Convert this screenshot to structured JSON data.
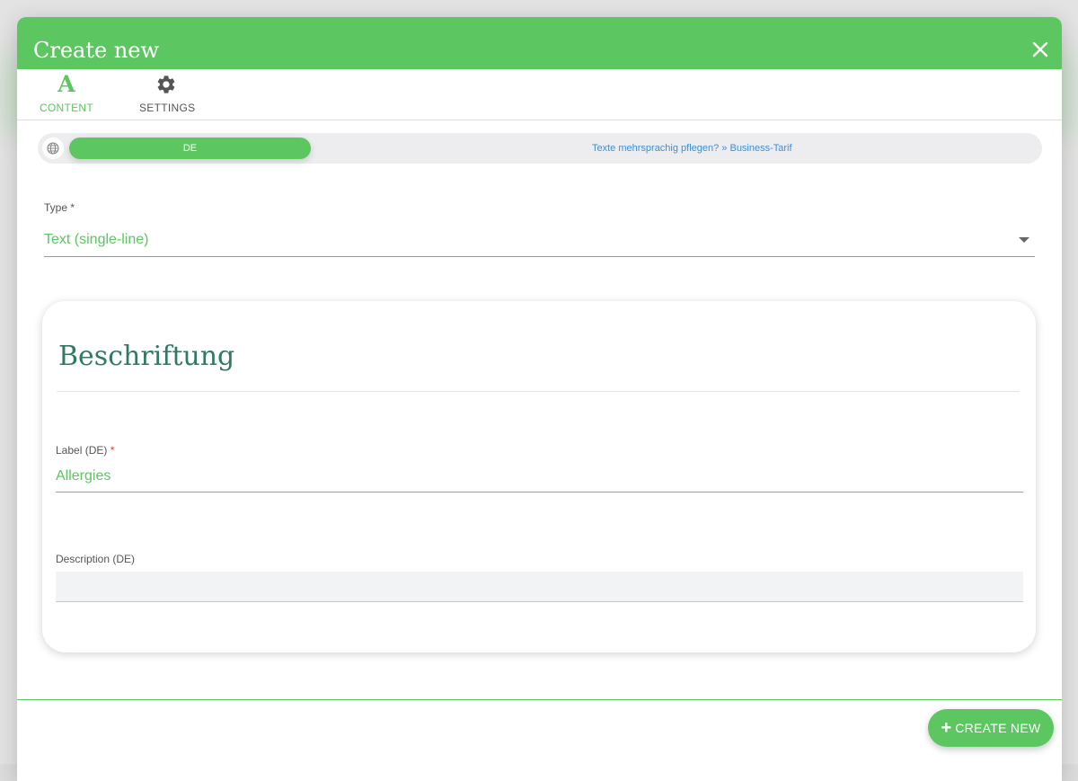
{
  "dialog": {
    "title": "Create new"
  },
  "tabs": [
    {
      "label": "CONTENT",
      "icon": "letter-a-icon",
      "active": true
    },
    {
      "label": "SETTINGS",
      "icon": "gear-icon",
      "active": false
    }
  ],
  "language_bar": {
    "active_language": "DE",
    "upgrade_link": "Texte mehrsprachig pflegen? » Business-Tarif"
  },
  "type_field": {
    "label": "Type",
    "required_marker": "*",
    "value": "Text (single-line)"
  },
  "section": {
    "title": "Beschriftung",
    "label_field": {
      "label": "Label (DE)",
      "required_marker": "*",
      "value": "Allergies"
    },
    "description_field": {
      "label": "Description (DE)",
      "value": ""
    }
  },
  "footer": {
    "create_button_label": "CREATE NEW"
  },
  "colors": {
    "primary_green": "#5cc660",
    "section_title": "#2f7a64",
    "link_blue": "#3d8fd6",
    "required_red": "#e53935"
  }
}
